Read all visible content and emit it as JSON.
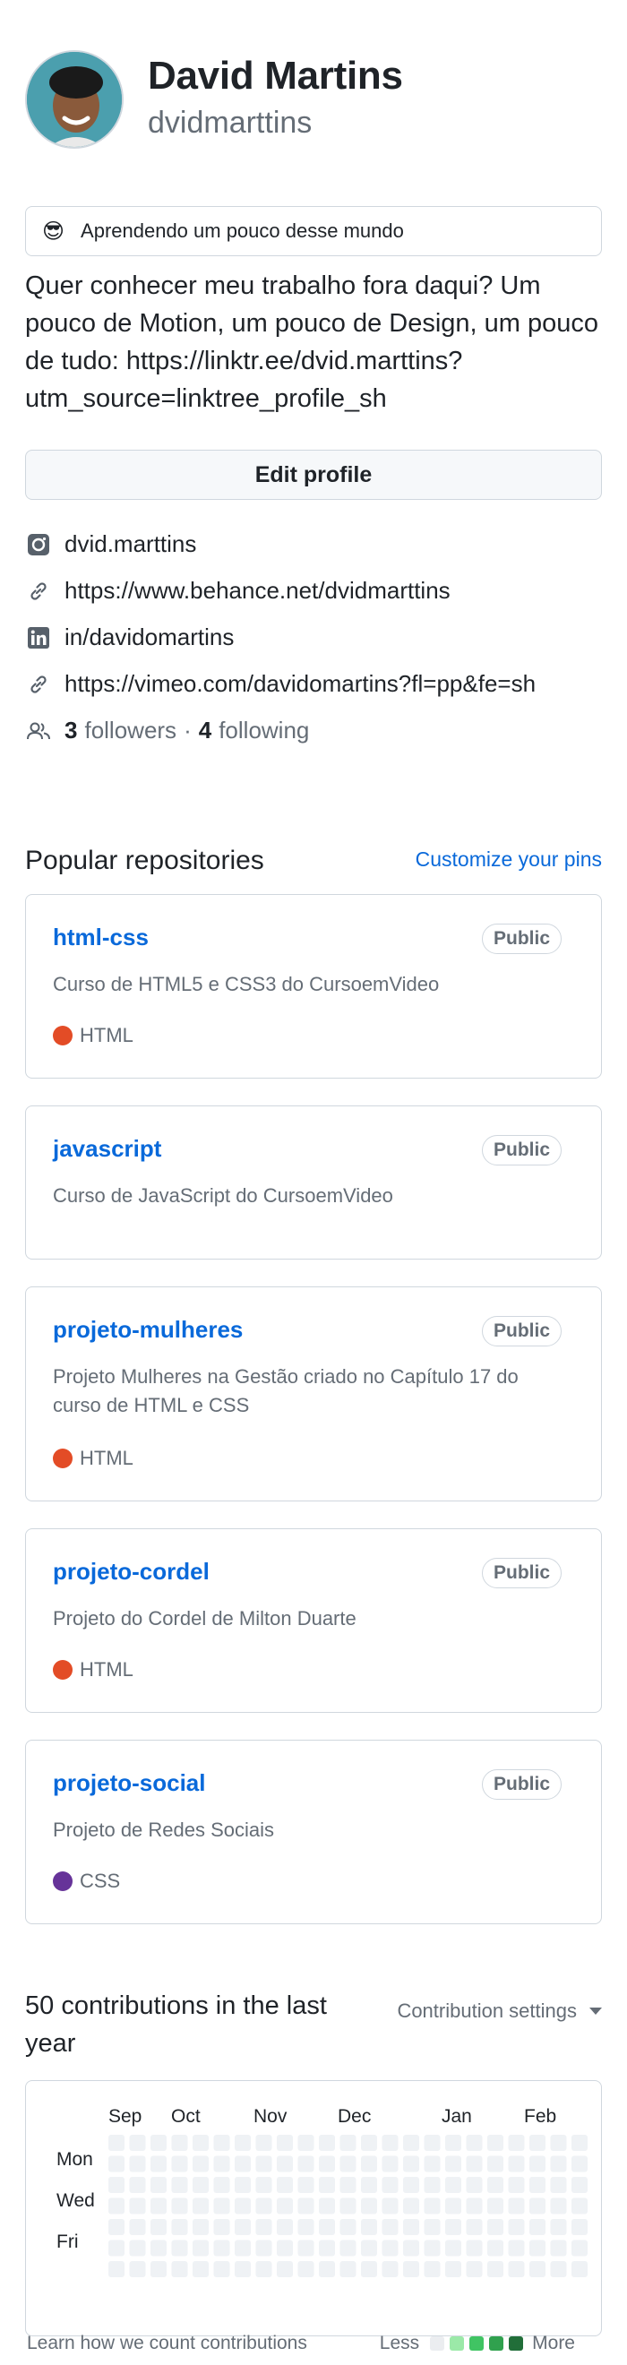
{
  "profile": {
    "name": "David Martins",
    "login": "dvidmarttins",
    "status_emoji": "😎",
    "status_text": "Aprendendo um pouco desse mundo",
    "bio": "Quer conhecer meu trabalho fora daqui? Um pouco de Motion, um pouco de Design, um pouco de tudo: https://linktr.ee/dvid.marttins?utm_source=linktree_profile_sh",
    "edit_label": "Edit profile"
  },
  "links": [
    {
      "icon": "instagram-icon",
      "text": "dvid.marttins"
    },
    {
      "icon": "link-icon",
      "text": "https://www.behance.net/dvidmarttins"
    },
    {
      "icon": "linkedin-icon",
      "text": "in/davidomartins"
    },
    {
      "icon": "link-icon",
      "text": "https://vimeo.com/davidomartins?fl=pp&fe=sh"
    }
  ],
  "follow": {
    "followers_count": "3",
    "followers_label": "followers",
    "separator": "·",
    "following_count": "4",
    "following_label": "following"
  },
  "popular": {
    "title": "Popular repositories",
    "customize_label": "Customize your pins",
    "repos": [
      {
        "name": "html-css",
        "visibility": "Public",
        "description": "Curso de HTML5 e CSS3 do CursoemVideo",
        "language": "HTML",
        "language_color": "#e34c26"
      },
      {
        "name": "javascript",
        "visibility": "Public",
        "description": "Curso de JavaScript do CursoemVideo",
        "language": "",
        "language_color": ""
      },
      {
        "name": "projeto-mulheres",
        "visibility": "Public",
        "description": "Projeto Mulheres na Gestão criado no Capítulo 17 do curso de HTML e CSS",
        "language": "HTML",
        "language_color": "#e34c26"
      },
      {
        "name": "projeto-cordel",
        "visibility": "Public",
        "description": "Projeto do Cordel de Milton Duarte",
        "language": "HTML",
        "language_color": "#e34c26"
      },
      {
        "name": "projeto-social",
        "visibility": "Public",
        "description": "Projeto de Redes Sociais",
        "language": "CSS",
        "language_color": "#663399"
      }
    ]
  },
  "contributions": {
    "title": "50 contributions in the last year",
    "settings_label": "Contribution settings",
    "months": [
      "Sep",
      "Oct",
      "Nov",
      "Dec",
      "Jan",
      "Feb"
    ],
    "days": [
      "Mon",
      "Wed",
      "Fri"
    ],
    "learn_label": "Learn how we count contributions",
    "less_label": "Less",
    "more_label": "More",
    "legend_colors": [
      "#ebedf0",
      "#9be9a8",
      "#40c463",
      "#30a14e",
      "#216e39"
    ]
  },
  "colors": {
    "accent": "#0969da",
    "muted": "#656d76",
    "border": "#d0d7de"
  }
}
